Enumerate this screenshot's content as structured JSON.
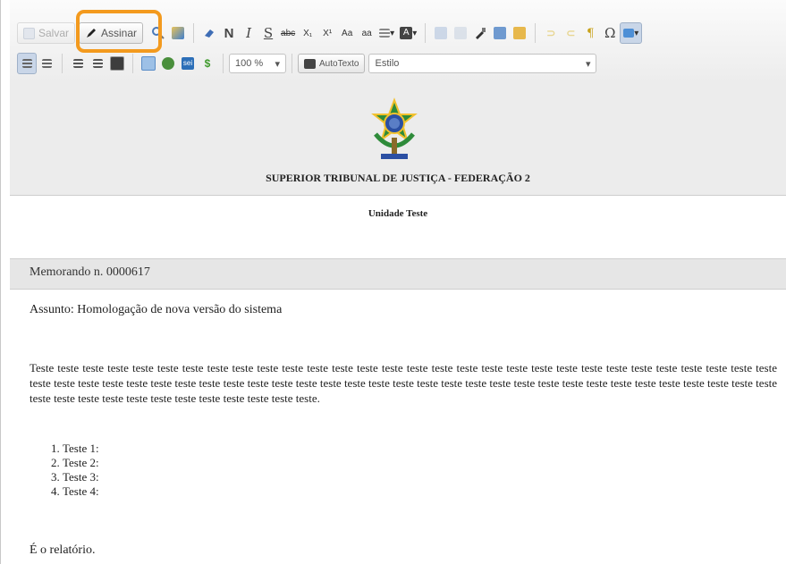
{
  "toolbar": {
    "save_label": "Salvar",
    "sign_label": "Assinar",
    "zoom_value": "100 %",
    "autotext_label": "AutoTexto",
    "style_value": "Estilo",
    "bold_glyph": "N",
    "italic_glyph": "I",
    "underline_glyph": "S",
    "strike_glyph": "abc",
    "subscript_glyph": "X₁",
    "superscript_glyph": "X¹",
    "omega_glyph": "Ω",
    "paragraph_glyph": "¶",
    "currency_glyph": "$"
  },
  "document": {
    "organization": "SUPERIOR TRIBUNAL DE JUSTIÇA - FEDERAÇÃO 2",
    "unit": "Unidade Teste",
    "memo_title": "Memorando n. 0000617",
    "subject": "Assunto: Homologação de nova versão do sistema",
    "paragraph": "Teste teste teste teste teste teste teste teste teste teste teste teste teste teste teste teste teste teste teste teste teste teste teste teste teste teste teste teste teste teste teste teste teste teste teste teste teste teste teste teste teste teste teste teste teste teste teste teste teste teste teste teste teste teste teste teste teste teste teste teste teste teste teste teste teste teste teste teste teste teste teste teste teste.",
    "list_items": [
      "Teste 1:",
      "Teste 2:",
      "Teste 3:",
      "Teste 4:"
    ],
    "closing": "É o relatório."
  },
  "colors": {
    "highlight": "#f39a1e",
    "emblem_green": "#2e8b3a",
    "emblem_yellow": "#f2c12e",
    "emblem_blue": "#2b4fa3"
  }
}
